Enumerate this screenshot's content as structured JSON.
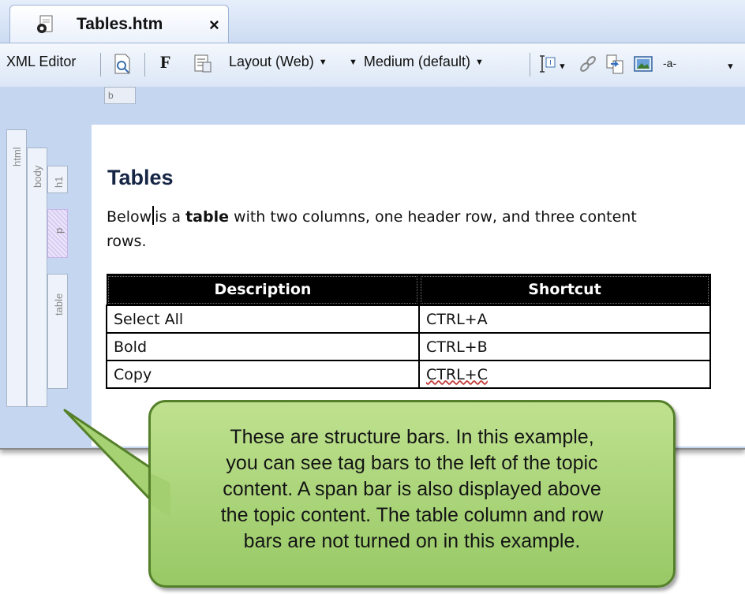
{
  "tab": {
    "title": "Tables.htm",
    "close_label": "×"
  },
  "toolbar": {
    "xml_editor_label": "XML Editor",
    "font_label": "F",
    "layout_label": "Layout (Web)",
    "medium_label": "Medium (default)",
    "style_label": "-a-"
  },
  "span_bar": {
    "label": "b"
  },
  "structure_bars": {
    "html": "html",
    "body": "body",
    "h1": "h1",
    "p": "p",
    "table": "table"
  },
  "document": {
    "heading": "Tables",
    "para_before_caret": "Below",
    "para_mid": "is a ",
    "para_bold": "table",
    "para_after": " with two columns, one header row, and three content rows.",
    "table": {
      "headers": [
        "Description",
        "Shortcut"
      ],
      "rows": [
        [
          "Select All",
          "CTRL+A"
        ],
        [
          "Bold",
          "CTRL+B"
        ],
        [
          "Copy",
          "CTRL+C"
        ]
      ]
    }
  },
  "callout": {
    "lines": [
      "These are structure bars. In this example,",
      "you can see tag bars to the left of the topic",
      "content. A span bar is also displayed above",
      "the topic content. The table column and row",
      "bars are not turned on in this example."
    ]
  }
}
